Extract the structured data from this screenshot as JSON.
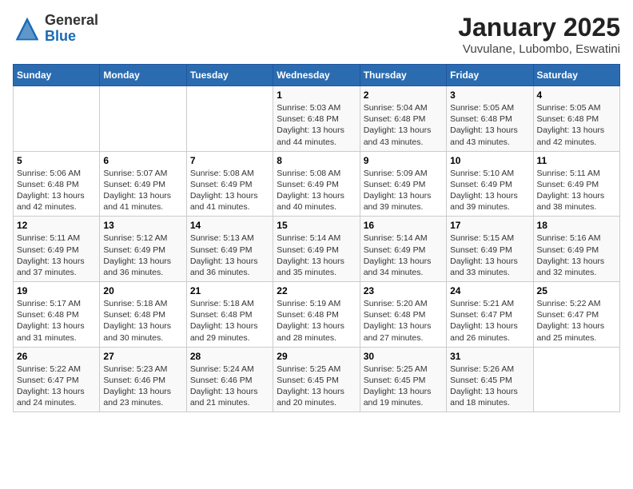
{
  "header": {
    "logo_general": "General",
    "logo_blue": "Blue",
    "title": "January 2025",
    "subtitle": "Vuvulane, Lubombo, Eswatini"
  },
  "days_of_week": [
    "Sunday",
    "Monday",
    "Tuesday",
    "Wednesday",
    "Thursday",
    "Friday",
    "Saturday"
  ],
  "weeks": [
    [
      {
        "day": "",
        "info": ""
      },
      {
        "day": "",
        "info": ""
      },
      {
        "day": "",
        "info": ""
      },
      {
        "day": "1",
        "info": "Sunrise: 5:03 AM\nSunset: 6:48 PM\nDaylight: 13 hours and 44 minutes."
      },
      {
        "day": "2",
        "info": "Sunrise: 5:04 AM\nSunset: 6:48 PM\nDaylight: 13 hours and 43 minutes."
      },
      {
        "day": "3",
        "info": "Sunrise: 5:05 AM\nSunset: 6:48 PM\nDaylight: 13 hours and 43 minutes."
      },
      {
        "day": "4",
        "info": "Sunrise: 5:05 AM\nSunset: 6:48 PM\nDaylight: 13 hours and 42 minutes."
      }
    ],
    [
      {
        "day": "5",
        "info": "Sunrise: 5:06 AM\nSunset: 6:48 PM\nDaylight: 13 hours and 42 minutes."
      },
      {
        "day": "6",
        "info": "Sunrise: 5:07 AM\nSunset: 6:49 PM\nDaylight: 13 hours and 41 minutes."
      },
      {
        "day": "7",
        "info": "Sunrise: 5:08 AM\nSunset: 6:49 PM\nDaylight: 13 hours and 41 minutes."
      },
      {
        "day": "8",
        "info": "Sunrise: 5:08 AM\nSunset: 6:49 PM\nDaylight: 13 hours and 40 minutes."
      },
      {
        "day": "9",
        "info": "Sunrise: 5:09 AM\nSunset: 6:49 PM\nDaylight: 13 hours and 39 minutes."
      },
      {
        "day": "10",
        "info": "Sunrise: 5:10 AM\nSunset: 6:49 PM\nDaylight: 13 hours and 39 minutes."
      },
      {
        "day": "11",
        "info": "Sunrise: 5:11 AM\nSunset: 6:49 PM\nDaylight: 13 hours and 38 minutes."
      }
    ],
    [
      {
        "day": "12",
        "info": "Sunrise: 5:11 AM\nSunset: 6:49 PM\nDaylight: 13 hours and 37 minutes."
      },
      {
        "day": "13",
        "info": "Sunrise: 5:12 AM\nSunset: 6:49 PM\nDaylight: 13 hours and 36 minutes."
      },
      {
        "day": "14",
        "info": "Sunrise: 5:13 AM\nSunset: 6:49 PM\nDaylight: 13 hours and 36 minutes."
      },
      {
        "day": "15",
        "info": "Sunrise: 5:14 AM\nSunset: 6:49 PM\nDaylight: 13 hours and 35 minutes."
      },
      {
        "day": "16",
        "info": "Sunrise: 5:14 AM\nSunset: 6:49 PM\nDaylight: 13 hours and 34 minutes."
      },
      {
        "day": "17",
        "info": "Sunrise: 5:15 AM\nSunset: 6:49 PM\nDaylight: 13 hours and 33 minutes."
      },
      {
        "day": "18",
        "info": "Sunrise: 5:16 AM\nSunset: 6:49 PM\nDaylight: 13 hours and 32 minutes."
      }
    ],
    [
      {
        "day": "19",
        "info": "Sunrise: 5:17 AM\nSunset: 6:48 PM\nDaylight: 13 hours and 31 minutes."
      },
      {
        "day": "20",
        "info": "Sunrise: 5:18 AM\nSunset: 6:48 PM\nDaylight: 13 hours and 30 minutes."
      },
      {
        "day": "21",
        "info": "Sunrise: 5:18 AM\nSunset: 6:48 PM\nDaylight: 13 hours and 29 minutes."
      },
      {
        "day": "22",
        "info": "Sunrise: 5:19 AM\nSunset: 6:48 PM\nDaylight: 13 hours and 28 minutes."
      },
      {
        "day": "23",
        "info": "Sunrise: 5:20 AM\nSunset: 6:48 PM\nDaylight: 13 hours and 27 minutes."
      },
      {
        "day": "24",
        "info": "Sunrise: 5:21 AM\nSunset: 6:47 PM\nDaylight: 13 hours and 26 minutes."
      },
      {
        "day": "25",
        "info": "Sunrise: 5:22 AM\nSunset: 6:47 PM\nDaylight: 13 hours and 25 minutes."
      }
    ],
    [
      {
        "day": "26",
        "info": "Sunrise: 5:22 AM\nSunset: 6:47 PM\nDaylight: 13 hours and 24 minutes."
      },
      {
        "day": "27",
        "info": "Sunrise: 5:23 AM\nSunset: 6:46 PM\nDaylight: 13 hours and 23 minutes."
      },
      {
        "day": "28",
        "info": "Sunrise: 5:24 AM\nSunset: 6:46 PM\nDaylight: 13 hours and 21 minutes."
      },
      {
        "day": "29",
        "info": "Sunrise: 5:25 AM\nSunset: 6:45 PM\nDaylight: 13 hours and 20 minutes."
      },
      {
        "day": "30",
        "info": "Sunrise: 5:25 AM\nSunset: 6:45 PM\nDaylight: 13 hours and 19 minutes."
      },
      {
        "day": "31",
        "info": "Sunrise: 5:26 AM\nSunset: 6:45 PM\nDaylight: 13 hours and 18 minutes."
      },
      {
        "day": "",
        "info": ""
      }
    ]
  ]
}
